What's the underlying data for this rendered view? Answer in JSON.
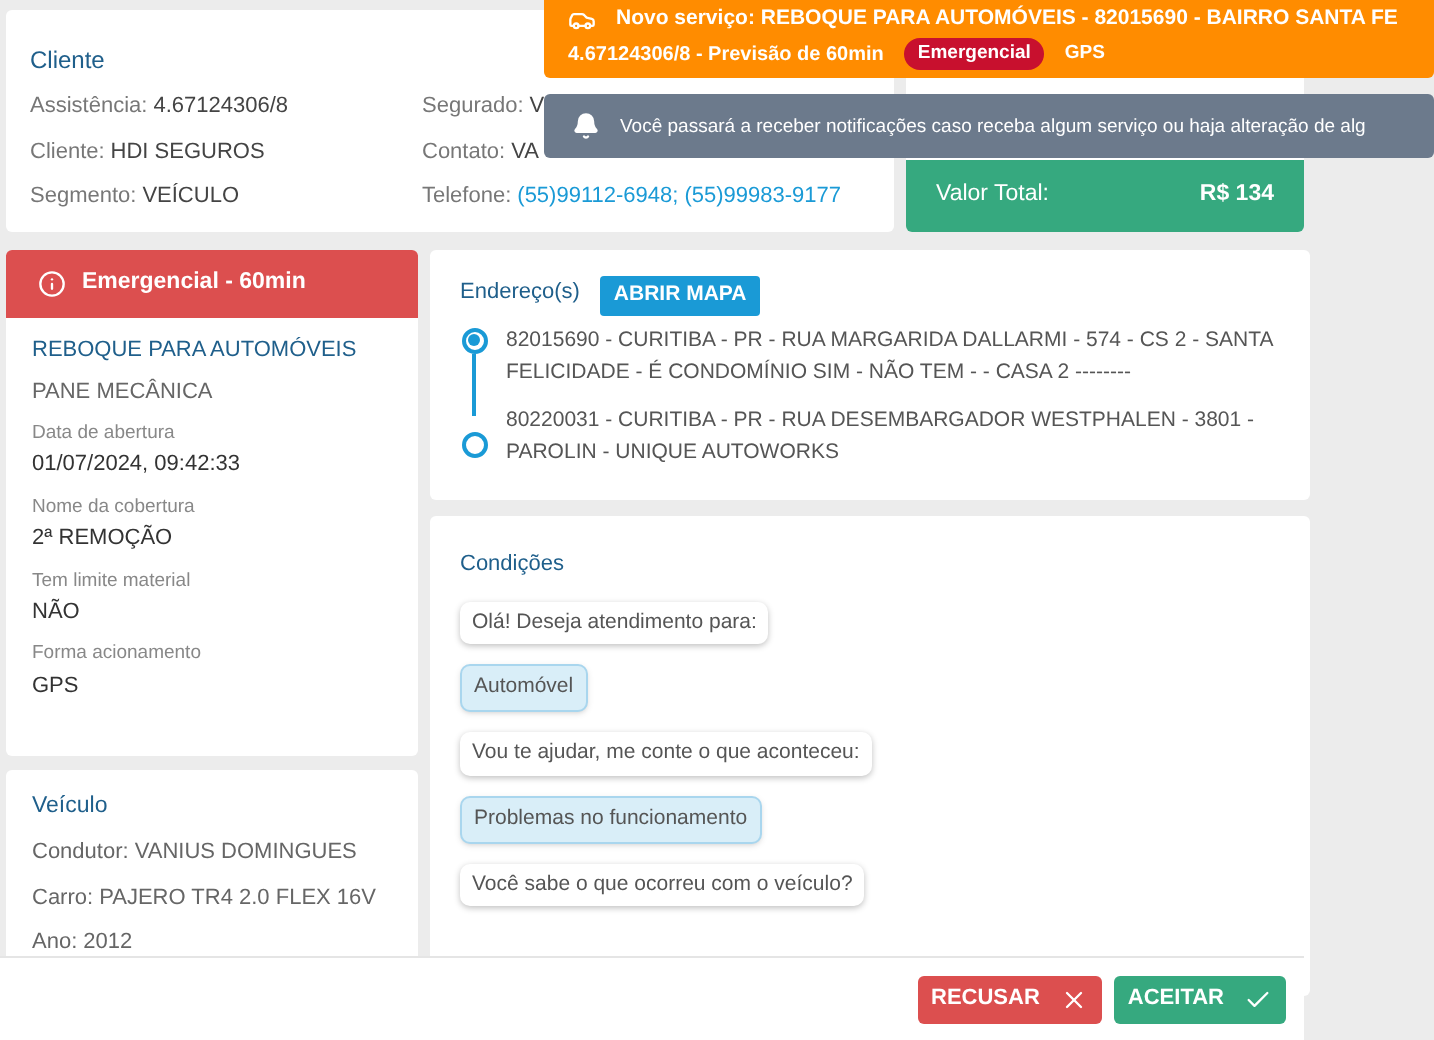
{
  "toasts": [
    {
      "kind": "service",
      "title": "Novo serviço: REBOQUE PARA AUTOMÓVEIS - 82015690 - BAIRRO SANTA FE",
      "subtitle": "4.67124306/8 - Previsão de 60min",
      "badges": [
        {
          "label": "Emergencial",
          "kind": "danger"
        },
        {
          "label": "GPS",
          "kind": "plain"
        }
      ]
    },
    {
      "kind": "info",
      "text": "Você passará a receber notificações caso receba algum serviço ou haja alteração de alg"
    }
  ],
  "client": {
    "title": "Cliente",
    "fields": [
      {
        "label": "Assistência:",
        "value": "4.67124306/8",
        "kind": "text"
      },
      {
        "label": "Segurado:",
        "value": "V",
        "kind": "text"
      },
      {
        "label": "Cliente:",
        "value": "HDI SEGUROS",
        "kind": "text"
      },
      {
        "label": "Contato:",
        "value": "VA",
        "kind": "text"
      },
      {
        "label": "Segmento:",
        "value": "VEÍCULO",
        "kind": "text"
      },
      {
        "label": "Telefone:",
        "value": "(55)99112-6948; (55)99983-9177",
        "kind": "link"
      }
    ]
  },
  "total": {
    "label": "Valor Total:",
    "value": "R$ 134"
  },
  "service": {
    "banner": "Emergencial - 60min",
    "title": "REBOQUE PARA AUTOMÓVEIS",
    "subtitle": "PANE MECÂNICA",
    "fields": [
      {
        "label": "Data de abertura",
        "value": "01/07/2024, 09:42:33"
      },
      {
        "label": "Nome da cobertura",
        "value": "2ª REMOÇÃO"
      },
      {
        "label": "Tem limite material",
        "value": "NÃO"
      },
      {
        "label": "Forma acionamento",
        "value": "GPS"
      }
    ]
  },
  "vehicle": {
    "title": "Veículo",
    "lines": [
      "Condutor: VANIUS DOMINGUES",
      "Carro: PAJERO TR4 2.0 FLEX 16V",
      "Ano: 2012"
    ]
  },
  "addresses": {
    "title": "Endereço(s)",
    "map_button": "ABRIR MAPA",
    "items": [
      {
        "text": "82015690 - CURITIBA - PR - RUA MARGARIDA DALLARMI - 574 - CS 2 - SANTA FELICIDADE - É CONDOMÍNIO SIM - NÃO TEM - - CASA 2 --------",
        "selected": true
      },
      {
        "text": "80220031 - CURITIBA - PR - RUA DESEMBARGADOR WESTPHALEN - 3801 - PAROLIN - UNIQUE AUTOWORKS",
        "selected": false
      }
    ]
  },
  "conditions": {
    "title": "Condições",
    "messages": [
      {
        "kind": "question",
        "text": "Olá! Deseja atendimento para:"
      },
      {
        "kind": "answer",
        "text": "Automóvel"
      },
      {
        "kind": "question",
        "text": "Vou te ajudar, me conte o que aconteceu:"
      },
      {
        "kind": "answer",
        "text": "Problemas no funcionamento"
      },
      {
        "kind": "question",
        "text": "Você sabe o que ocorreu com o veículo?"
      }
    ]
  },
  "actions": [
    {
      "label": "RECUSAR",
      "kind": "reject"
    },
    {
      "label": "ACEITAR",
      "kind": "accept"
    }
  ]
}
